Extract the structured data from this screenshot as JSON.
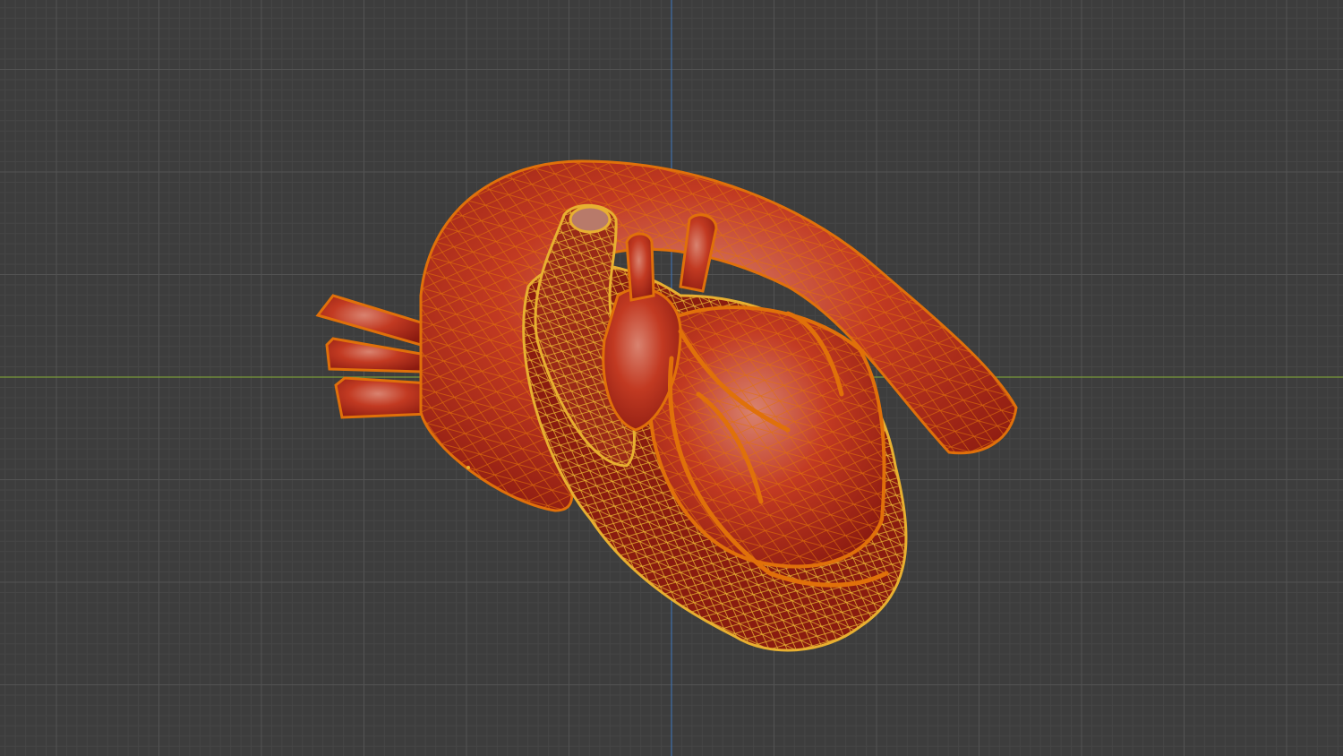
{
  "viewport": {
    "mode": "3d-viewport-edit-wireframe-overlay",
    "object": "heart-mesh",
    "colors": {
      "background": "#3d3d3d",
      "grid_minor": "#464646",
      "grid_major": "#535353",
      "x_axis": "#7a9a3a",
      "y_axis": "#3f6fa8",
      "mesh_red": "#b8281a",
      "mesh_dark": "#7a1410",
      "wire_orange": "#e0700a",
      "wire_yellow": "#e8b030"
    }
  }
}
